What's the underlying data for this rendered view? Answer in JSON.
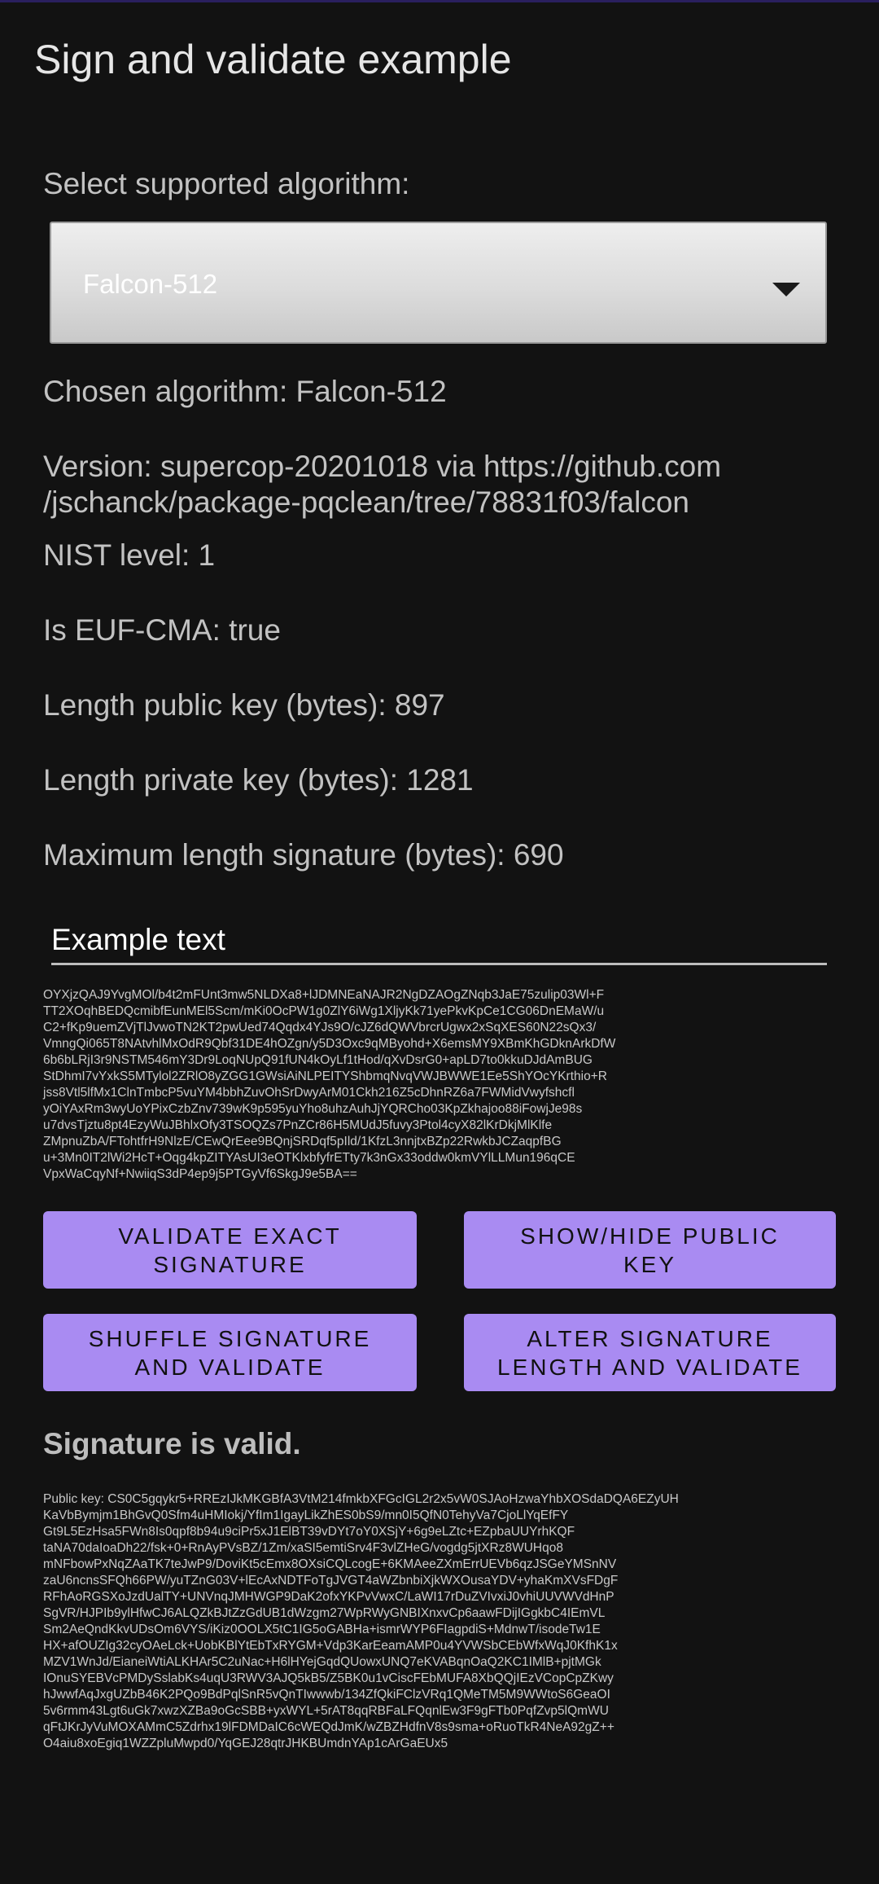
{
  "app": {
    "title": "Sign and validate example"
  },
  "algorithm_select": {
    "label": "Select supported algorithm:",
    "selected": "Falcon-512"
  },
  "info": {
    "chosen": "Chosen algorithm: Falcon-512",
    "version_line1": "Version: supercop-20201018 via https://github.com",
    "version_line2": "/jschanck/package-pqclean/tree/78831f03/falcon",
    "nist_level": "NIST level: 1",
    "euf_cma": "Is EUF-CMA: true",
    "public_key_length": "Length public key (bytes): 897",
    "private_key_length": "Length private key (bytes): 1281",
    "max_signature_length": "Maximum length signature (bytes): 690"
  },
  "example_input": {
    "value": "Example text"
  },
  "signature": {
    "text": "OYXjzQAJ9YvgMOl/b4t2mFUnt3mw5NLDXa8+lJDMNEaNAJR2NgDZAOgZNqb3JaE75zulip03Wl+F\nTT2XOqhBEDQcmibfEunMEl5Scm/mKi0OcPW1g0ZlY6iWg1XljyKk71yePkvKpCe1CG06DnEMaW/u\nC2+fKp9uemZVjTlJvwoTN2KT2pwUed74Qqdx4YJs9O/cJZ6dQWVbrcrUgwx2xSqXES60N22sQx3/\nVmngQi065T8NAtvhlMxOdR9Qbf31DE4hOZgn/y5D3Oxc9qMByohd+X6emsMY9XBmKhGDknArkDfW\n6b6bLRjI3r9NSTM546mY3Dr9LoqNUpQ91fUN4kOyLf1tHod/qXvDsrG0+apLD7to0kkuDJdAmBUG\nStDhmI7vYxkS5MTylol2ZRlO8yZGG1GWsiAiNLPEITYShbmqNvqVWJBWWE1Ee5ShYOcYKrthio+R\njss8Vtl5lfMx1ClnTmbcP5vuYM4bbhZuvOhSrDwyArM01Ckh216Z5cDhnRZ6a7FWMidVwyfshcfl\nyOiYAxRm3wyUoYPixCzbZnv739wK9p595yuYho8uhzAuhJjYQRCho03KpZkhajoo88iFowjJe98s\nu7dvsTjztu8pt4EzyWuJBhlxOfy3TSOQZs7PnZCr86H5MUdJ5fuvy3Ptol4cyX82lKrDkjMlKlfe\nZMpnuZbA/FTohtfrH9NlzE/CEwQrEee9BQnjSRDqf5pIld/1KfzL3nnjtxBZp22RwkbJCZaqpfBG\nu+3Mn0IT2lWi2HcT+Oqg4kpZITYAsUI3eOTKlxbfyfrETty7k3nGx33oddw0kmVYlLLMun196qCE\nVpxWaCqyNf+NwiiqS3dP4ep9j5PTGyVf6SkgJ9e5BA=="
  },
  "buttons": {
    "validate_exact": "VALIDATE EXACT\nSIGNATURE",
    "show_hide_key": "SHOW/HIDE PUBLIC\nKEY",
    "shuffle": "SHUFFLE SIGNATURE\nAND VALIDATE",
    "alter_length": "ALTER SIGNATURE\nLENGTH AND VALIDATE"
  },
  "status": {
    "text": "Signature is valid."
  },
  "public_key": {
    "text": "Public key: CS0C5gqykr5+RREzIJkMKGBfA3VtM214fmkbXFGcIGL2r2x5vW0SJAoHzwaYhbXOSdaDQA6EZyUH\nKaVbBymjm1BhGvQ0Sfm4uHMIokj/YfIm1IgayLikZhES0bS9/mn0I5QfN0TehyVa7CjoLlYqEfFY\nGt9L5EzHsa5FWn8Is0qpf8b94u9ciPr5xJ1ElBT39vDYt7oY0XSjY+6g9eLZtc+EZpbaUUYrhKQF\ntaNA70daIoaDh22/fsk+0+RnAyPVsBZ/1Zm/xaSI5emtiSrv4F3vlZHeG/vogdg5jtXRz8WUHqo8\nmNFbowPxNqZAaTK7teJwP9/DoviKt5cEmx8OXsiCQLcogE+6KMAeeZXmErrUEVb6qzJSGeYMSnNV\nzaU6ncnsSFQh66PW/yuTZnG03V+lEcAxNDTFoTgJVGT4aWZbnbiXjkWXOusaYDV+yhaKmXVsFDgF\nRFhAoRGSXoJzdUalTY+UNVnqJMHWGP9DaK2ofxYKPvVwxC/LaWI17rDuZVIvxiJ0vhiUUVWVdHnP\nSgVR/HJPIb9ylHfwCJ6ALQZkBJtZzGdUB1dWzgm27WpRWyGNBIXnxvCp6aawFDijIGgkbC4IEmVL\nSm2AeQndKkvUDsOm6VYS/iKiz0OOLX5tC1IG5oGABHa+ismrWYP6FIagpdiS+MdnwT/isodeTw1E\nHX+afOUZIg32cyOAeLck+UobKBlYtEbTxRYGM+Vdp3KarEeamAMP0u4YVWSbCEbWfxWqJ0KfhK1x\nMZV1WnJd/EianeiWtiALKHAr5C2uNac+H6lHYejGqdQUowxUNQ7eKVABqnOaQ2KC1IMlB+pjtMGk\nIOnuSYEBVcPMDySslabKs4uqU3RWV3AJQ5kB5/Z5BK0u1vCiscFEbMUFA8XbQQjIEzVCopCpZKwy\nhJwwfAqJxgUZbB46K2PQo9BdPqlSnR5vQnTIwwwb/134ZfQkiFClzVRq1QMeTM5M9WWtoS6GeaOI\n5v6rmm43Lgt6uGk7xwzXZBa9oGcSBB+yxWYL+5rAT8qqRBFaLFQqnlEw3F9gFTb0PqfZvp5lQmWU\nqFtJKrJyVuMOXAMmC5Zdrhx19lFDMDaIC6cWEQdJmK/wZBZHdfnV8s9sma+oRuoTkR4NeA92gZ++\nO4aiu8xoEgiq1WZZpluMwpd0/YqGEJ28qtrJHKBUmdnYAp1cArGaEUx5"
  },
  "colors": {
    "background": "#121212",
    "button": "#a98bf2",
    "button_text": "#111111"
  }
}
